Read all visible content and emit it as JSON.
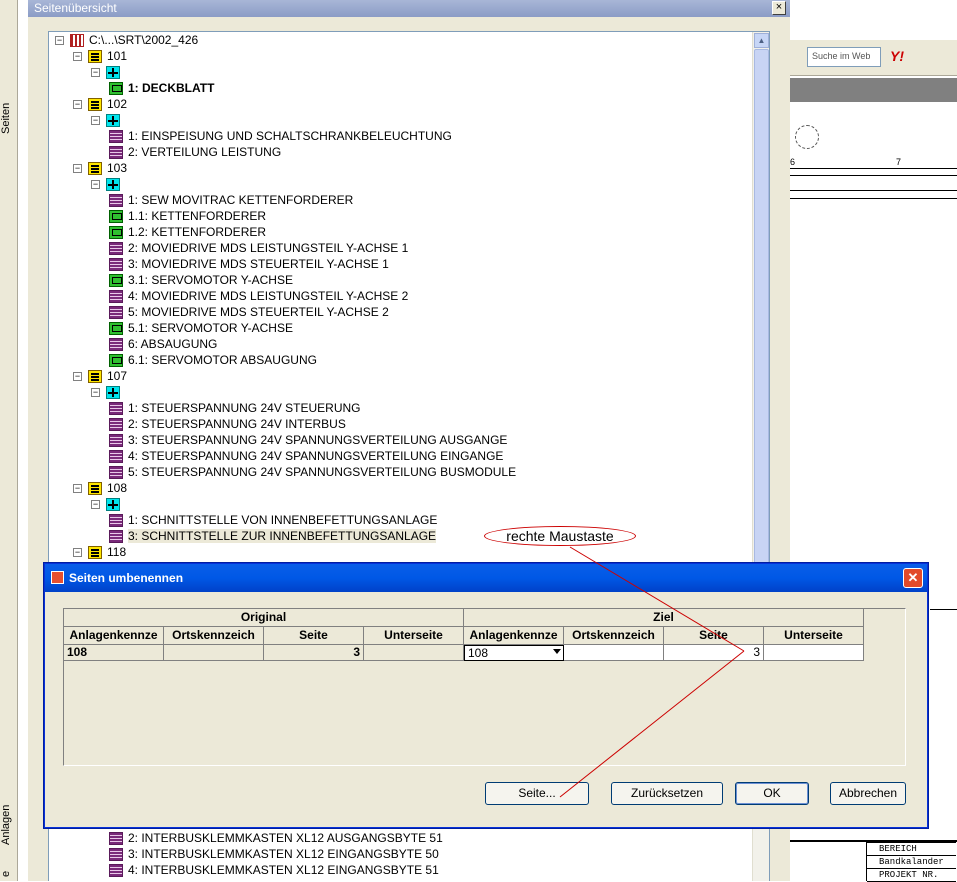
{
  "background": {
    "tabs": [
      "Seiten",
      "Anlagen",
      "e"
    ],
    "search_placeholder": "Suche im Web",
    "yahoo_logo": "Y!",
    "ruler_labels": [
      "6",
      "7"
    ],
    "title_block": [
      "BEREICH",
      "Bandkalander",
      "PROJEKT NR."
    ]
  },
  "tree_window": {
    "title": "Seitenübersicht",
    "close": "×",
    "rows": [
      {
        "type": "root",
        "indent": 0,
        "label": "C:\\...\\SRT\\2002_426",
        "expander": "−"
      },
      {
        "type": "folder",
        "indent": 1,
        "label": "101",
        "expander": "−"
      },
      {
        "type": "loc",
        "indent": 2,
        "label": "",
        "expander": "−"
      },
      {
        "type": "green",
        "indent": 3,
        "label": "1: DECKBLATT",
        "bold": true
      },
      {
        "type": "folder",
        "indent": 1,
        "label": "102",
        "expander": "−"
      },
      {
        "type": "loc",
        "indent": 2,
        "label": "",
        "expander": "−"
      },
      {
        "type": "page",
        "indent": 3,
        "label": "1: EINSPEISUNG UND SCHALTSCHRANKBELEUCHTUNG"
      },
      {
        "type": "page",
        "indent": 3,
        "label": "2: VERTEILUNG LEISTUNG"
      },
      {
        "type": "folder",
        "indent": 1,
        "label": "103",
        "expander": "−"
      },
      {
        "type": "loc",
        "indent": 2,
        "label": "",
        "expander": "−"
      },
      {
        "type": "page",
        "indent": 3,
        "label": "1: SEW MOVITRAC KETTENFORDERER"
      },
      {
        "type": "green",
        "indent": 3,
        "label": "1.1: KETTENFORDERER"
      },
      {
        "type": "green",
        "indent": 3,
        "label": "1.2: KETTENFORDERER"
      },
      {
        "type": "page",
        "indent": 3,
        "label": "2: MOVIEDRIVE MDS LEISTUNGSTEIL Y-ACHSE 1"
      },
      {
        "type": "page",
        "indent": 3,
        "label": "3: MOVIEDRIVE MDS STEUERTEIL Y-ACHSE 1"
      },
      {
        "type": "green",
        "indent": 3,
        "label": "3.1: SERVOMOTOR Y-ACHSE"
      },
      {
        "type": "page",
        "indent": 3,
        "label": "4: MOVIEDRIVE MDS LEISTUNGSTEIL Y-ACHSE 2"
      },
      {
        "type": "page",
        "indent": 3,
        "label": "5: MOVIEDRIVE MDS STEUERTEIL Y-ACHSE 2"
      },
      {
        "type": "green",
        "indent": 3,
        "label": "5.1: SERVOMOTOR Y-ACHSE"
      },
      {
        "type": "page",
        "indent": 3,
        "label": "6: ABSAUGUNG"
      },
      {
        "type": "green",
        "indent": 3,
        "label": "6.1: SERVOMOTOR ABSAUGUNG"
      },
      {
        "type": "folder",
        "indent": 1,
        "label": "107",
        "expander": "−"
      },
      {
        "type": "loc",
        "indent": 2,
        "label": "",
        "expander": "−"
      },
      {
        "type": "page",
        "indent": 3,
        "label": "1: STEUERSPANNUNG 24V STEUERUNG"
      },
      {
        "type": "page",
        "indent": 3,
        "label": "2: STEUERSPANNUNG 24V INTERBUS"
      },
      {
        "type": "page",
        "indent": 3,
        "label": "3: STEUERSPANNUNG 24V SPANNUNGSVERTEILUNG AUSGANGE"
      },
      {
        "type": "page",
        "indent": 3,
        "label": "4: STEUERSPANNUNG 24V SPANNUNGSVERTEILUNG EINGANGE"
      },
      {
        "type": "page",
        "indent": 3,
        "label": "5: STEUERSPANNUNG 24V SPANNUNGSVERTEILUNG BUSMODULE"
      },
      {
        "type": "folder",
        "indent": 1,
        "label": "108",
        "expander": "−"
      },
      {
        "type": "loc",
        "indent": 2,
        "label": "",
        "expander": "−"
      },
      {
        "type": "page",
        "indent": 3,
        "label": "1: SCHNITTSTELLE VON INNENBEFETTUNGSANLAGE"
      },
      {
        "type": "page",
        "indent": 3,
        "label": "3: SCHNITTSTELLE ZUR INNENBEFETTUNGSANLAGE",
        "selected": true
      },
      {
        "type": "folder",
        "indent": 1,
        "label": "118",
        "expander": "−"
      }
    ],
    "rows_below": [
      {
        "type": "page",
        "indent": 3,
        "label": "2: INTERBUSKLEMMKASTEN XL12 AUSGANGSBYTE 51"
      },
      {
        "type": "page",
        "indent": 3,
        "label": "3: INTERBUSKLEMMKASTEN XL12 EINGANGSBYTE 50"
      },
      {
        "type": "page",
        "indent": 3,
        "label": "4: INTERBUSKLEMMKASTEN XL12 EINGANGSBYTE 51"
      }
    ]
  },
  "annotation": "rechte Maustaste",
  "dialog": {
    "title": "Seiten umbenennen",
    "close": "✕",
    "group_original": "Original",
    "group_ziel": "Ziel",
    "columns": [
      "Anlagenkennze",
      "Ortskennzeich",
      "Seite",
      "Unterseite"
    ],
    "original_row": {
      "anlage": "108",
      "ort": "",
      "seite": "3",
      "unterseite": ""
    },
    "ziel_row": {
      "anlage": "108",
      "ort": "",
      "seite": "3",
      "unterseite": ""
    },
    "buttons": {
      "seite": "Seite...",
      "reset": "Zurücksetzen",
      "ok": "OK",
      "cancel": "Abbrechen"
    }
  }
}
